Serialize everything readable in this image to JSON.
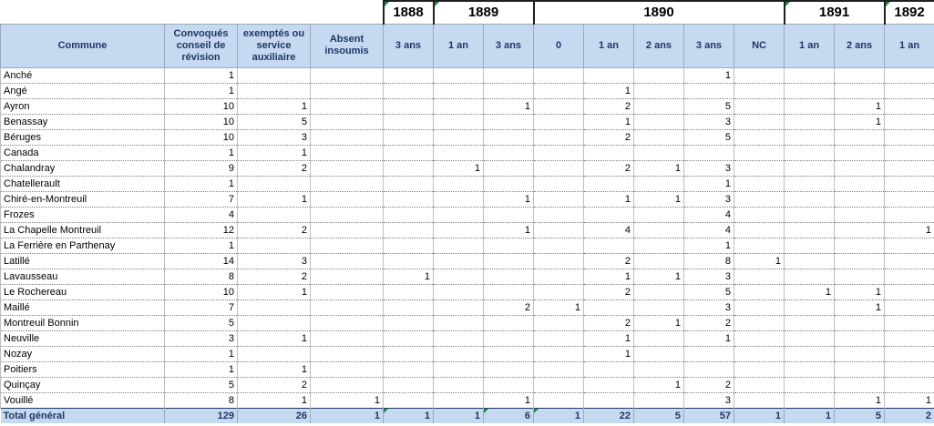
{
  "years": [
    "1888",
    "1889",
    "1890",
    "1891",
    "1892"
  ],
  "headers": [
    "Commune",
    "Convoqués conseil de révision",
    "exemptés ou service auxiliaire",
    "Absent insoumis",
    "3 ans",
    "1 an",
    "3 ans",
    "0",
    "1 an",
    "2 ans",
    "3 ans",
    "NC",
    "1 an",
    "2 ans",
    "1 an"
  ],
  "rows": [
    [
      "Anché",
      "1",
      "",
      "",
      "",
      "",
      "",
      "",
      "",
      "",
      "1",
      "",
      "",
      "",
      ""
    ],
    [
      "Angé",
      "1",
      "",
      "",
      "",
      "",
      "",
      "",
      "1",
      "",
      "",
      "",
      "",
      "",
      ""
    ],
    [
      "Ayron",
      "10",
      "1",
      "",
      "",
      "",
      "1",
      "",
      "2",
      "",
      "5",
      "",
      "",
      "1",
      ""
    ],
    [
      "Benassay",
      "10",
      "5",
      "",
      "",
      "",
      "",
      "",
      "1",
      "",
      "3",
      "",
      "",
      "1",
      ""
    ],
    [
      "Béruges",
      "10",
      "3",
      "",
      "",
      "",
      "",
      "",
      "2",
      "",
      "5",
      "",
      "",
      "",
      ""
    ],
    [
      "Canada",
      "1",
      "1",
      "",
      "",
      "",
      "",
      "",
      "",
      "",
      "",
      "",
      "",
      "",
      ""
    ],
    [
      "Chalandray",
      "9",
      "2",
      "",
      "",
      "1",
      "",
      "",
      "2",
      "1",
      "3",
      "",
      "",
      "",
      ""
    ],
    [
      "Chatellerault",
      "1",
      "",
      "",
      "",
      "",
      "",
      "",
      "",
      "",
      "1",
      "",
      "",
      "",
      ""
    ],
    [
      "Chiré-en-Montreuil",
      "7",
      "1",
      "",
      "",
      "",
      "1",
      "",
      "1",
      "1",
      "3",
      "",
      "",
      "",
      ""
    ],
    [
      "Frozes",
      "4",
      "",
      "",
      "",
      "",
      "",
      "",
      "",
      "",
      "4",
      "",
      "",
      "",
      ""
    ],
    [
      "La Chapelle Montreuil",
      "12",
      "2",
      "",
      "",
      "",
      "1",
      "",
      "4",
      "",
      "4",
      "",
      "",
      "",
      "1"
    ],
    [
      "La Ferrière en Parthenay",
      "1",
      "",
      "",
      "",
      "",
      "",
      "",
      "",
      "",
      "1",
      "",
      "",
      "",
      ""
    ],
    [
      "Latillé",
      "14",
      "3",
      "",
      "",
      "",
      "",
      "",
      "2",
      "",
      "8",
      "1",
      "",
      "",
      ""
    ],
    [
      "Lavausseau",
      "8",
      "2",
      "",
      "1",
      "",
      "",
      "",
      "1",
      "1",
      "3",
      "",
      "",
      "",
      ""
    ],
    [
      "Le Rochereau",
      "10",
      "1",
      "",
      "",
      "",
      "",
      "",
      "2",
      "",
      "5",
      "",
      "1",
      "1",
      ""
    ],
    [
      "Maillé",
      "7",
      "",
      "",
      "",
      "",
      "2",
      "1",
      "",
      "",
      "3",
      "",
      "",
      "1",
      ""
    ],
    [
      "Montreuil Bonnin",
      "5",
      "",
      "",
      "",
      "",
      "",
      "",
      "2",
      "1",
      "2",
      "",
      "",
      "",
      ""
    ],
    [
      "Neuville",
      "3",
      "1",
      "",
      "",
      "",
      "",
      "",
      "1",
      "",
      "1",
      "",
      "",
      "",
      ""
    ],
    [
      "Nozay",
      "1",
      "",
      "",
      "",
      "",
      "",
      "",
      "1",
      "",
      "",
      "",
      "",
      "",
      ""
    ],
    [
      "Poitiers",
      "1",
      "1",
      "",
      "",
      "",
      "",
      "",
      "",
      "",
      "",
      "",
      "",
      "",
      ""
    ],
    [
      "Quinçay",
      "5",
      "2",
      "",
      "",
      "",
      "",
      "",
      "",
      "1",
      "2",
      "",
      "",
      "",
      ""
    ],
    [
      "Vouillé",
      "8",
      "1",
      "1",
      "",
      "",
      "1",
      "",
      "",
      "",
      "3",
      "",
      "",
      "1",
      "1"
    ]
  ],
  "total": [
    "Total général",
    "129",
    "26",
    "1",
    "1",
    "1",
    "6",
    "1",
    "22",
    "5",
    "57",
    "1",
    "1",
    "5",
    "2"
  ]
}
